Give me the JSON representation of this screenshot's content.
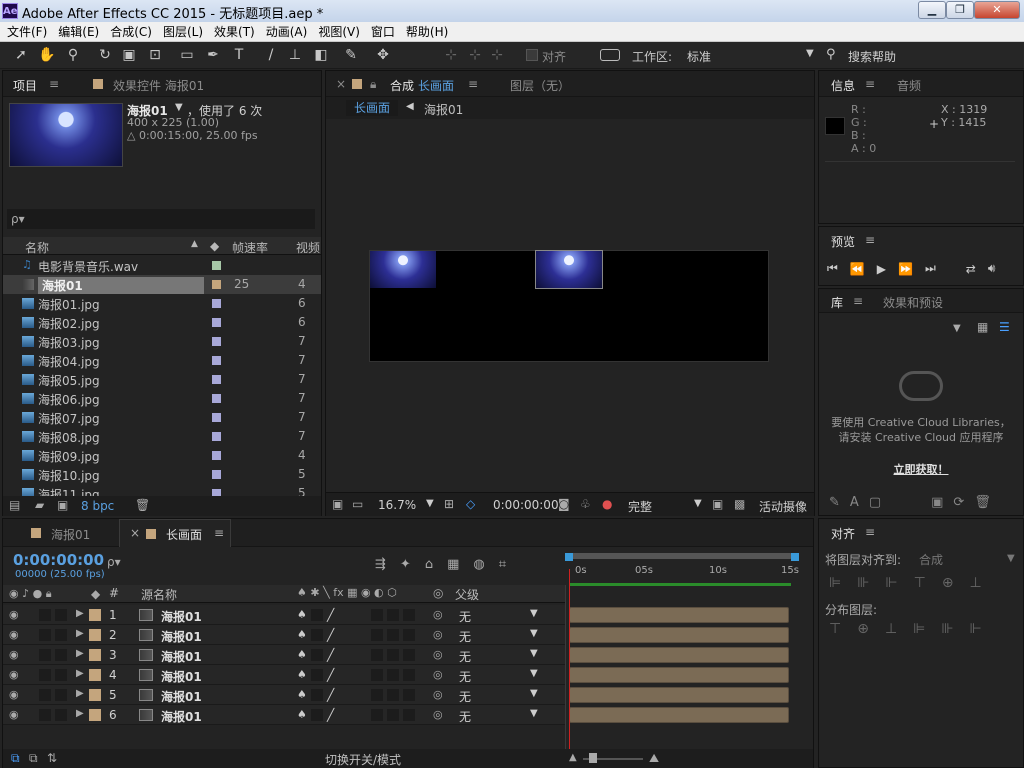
{
  "window": {
    "title": "Adobe After Effects CC 2015 - 无标题项目.aep *",
    "logo": "Ae"
  },
  "menu": [
    "文件(F)",
    "编辑(E)",
    "合成(C)",
    "图层(L)",
    "效果(T)",
    "动画(A)",
    "视图(V)",
    "窗口",
    "帮助(H)"
  ],
  "toolbar": {
    "snap_label": "对齐",
    "workspace_label": "工作区:",
    "workspace_value": "标准",
    "search_help": "搜索帮助"
  },
  "project_panel": {
    "tab_project": "项目",
    "tab_effects": "效果控件 海报01",
    "selected_name": "海报01",
    "usage": "，使用了 6 次",
    "dimensions": "400 x 225 (1.00)",
    "duration": "△ 0:00:15:00, 25.00 fps",
    "search_placeholder": "ρ▾",
    "columns": {
      "name": "名称",
      "fps": "帧速率",
      "video": "视频"
    },
    "items": [
      {
        "name": "电影背景音乐.wav",
        "fps": "",
        "video": "",
        "type": "audio",
        "label_color": "#a8c8a8"
      },
      {
        "name": "海报01",
        "fps": "25",
        "video": "4",
        "type": "comp",
        "label_color": "#c4a57d"
      },
      {
        "name": "海报01.jpg",
        "fps": "",
        "video": "6",
        "type": "image",
        "label_color": "#a8a8d8"
      },
      {
        "name": "海报02.jpg",
        "fps": "",
        "video": "6",
        "type": "image",
        "label_color": "#a8a8d8"
      },
      {
        "name": "海报03.jpg",
        "fps": "",
        "video": "7",
        "type": "image",
        "label_color": "#a8a8d8"
      },
      {
        "name": "海报04.jpg",
        "fps": "",
        "video": "7",
        "type": "image",
        "label_color": "#a8a8d8"
      },
      {
        "name": "海报05.jpg",
        "fps": "",
        "video": "7",
        "type": "image",
        "label_color": "#a8a8d8"
      },
      {
        "name": "海报06.jpg",
        "fps": "",
        "video": "7",
        "type": "image",
        "label_color": "#a8a8d8"
      },
      {
        "name": "海报07.jpg",
        "fps": "",
        "video": "7",
        "type": "image",
        "label_color": "#a8a8d8"
      },
      {
        "name": "海报08.jpg",
        "fps": "",
        "video": "7",
        "type": "image",
        "label_color": "#a8a8d8"
      },
      {
        "name": "海报09.jpg",
        "fps": "",
        "video": "4",
        "type": "image",
        "label_color": "#a8a8d8"
      },
      {
        "name": "海报10.jpg",
        "fps": "",
        "video": "5",
        "type": "image",
        "label_color": "#a8a8d8"
      },
      {
        "name": "海报11.jpg",
        "fps": "",
        "video": "5",
        "type": "image",
        "label_color": "#a8a8d8"
      }
    ],
    "bpc": "8 bpc"
  },
  "comp_panel": {
    "tab_comp_prefix": "合成",
    "tab_comp_name": "长画面",
    "tab_layer": "图层（无）",
    "crumb_active": "长画面",
    "crumb_next": "海报01",
    "zoom": "16.7%",
    "time": "0:00:00:00",
    "resolution": "完整",
    "camera": "活动摄像机"
  },
  "info_panel": {
    "tab_info": "信息",
    "tab_audio": "音频",
    "r": "R :",
    "g": "G :",
    "b": "B :",
    "a": "A : 0",
    "x": "X : 1319",
    "y": "Y : 1415"
  },
  "preview_panel": {
    "tab": "预览"
  },
  "library_panel": {
    "tab_library": "库",
    "tab_effects": "效果和预设",
    "message1": "要使用 Creative Cloud Libraries，",
    "message2": "请安装 Creative Cloud 应用程序",
    "link": "立即获取！"
  },
  "align_panel": {
    "tab": "对齐",
    "align_to_label": "将图层对齐到:",
    "align_to_value": "合成",
    "distribute_label": "分布图层:"
  },
  "timeline": {
    "tab_inactive": "海报01",
    "tab_active": "长画面",
    "timecode": "0:00:00:00",
    "frames": "00000 (25.00 fps)",
    "col_num": "#",
    "col_source": "源名称",
    "col_parent": "父级",
    "ruler": [
      "0s",
      "05s",
      "10s",
      "15s"
    ],
    "layers": [
      {
        "num": "1",
        "source": "海报01",
        "parent": "无"
      },
      {
        "num": "2",
        "source": "海报01",
        "parent": "无"
      },
      {
        "num": "3",
        "source": "海报01",
        "parent": "无"
      },
      {
        "num": "4",
        "source": "海报01",
        "parent": "无"
      },
      {
        "num": "5",
        "source": "海报01",
        "parent": "无"
      },
      {
        "num": "6",
        "source": "海报01",
        "parent": "无"
      }
    ],
    "toggle_label": "切换开关/模式"
  }
}
